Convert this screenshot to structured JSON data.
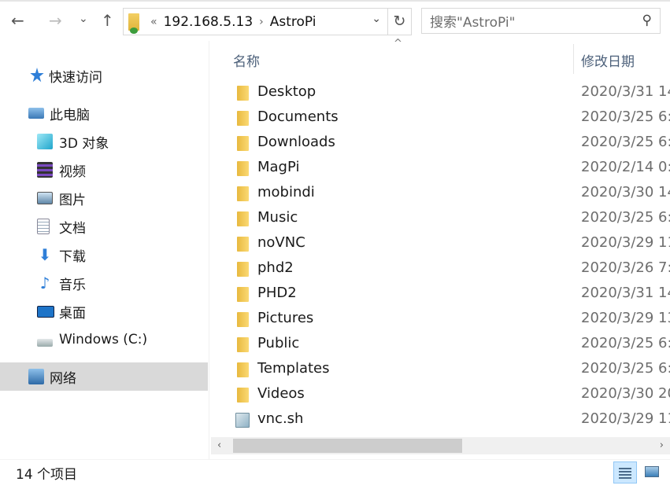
{
  "toolbar": {
    "back": "←",
    "forward": "→",
    "recent": "⌄",
    "up": "↑",
    "address": {
      "overflow": "«",
      "crumbs": [
        "192.168.5.13",
        "AstroPi"
      ],
      "separator": "›"
    },
    "dropdown": "⌄",
    "refresh": "↻",
    "search_placeholder": "搜索\"AstroPi\"",
    "search_icon": "⚲"
  },
  "sidebar": {
    "items": [
      {
        "label": "快速访问",
        "icon": "star-icon",
        "color": "#2f7fd8"
      },
      {
        "label": "此电脑",
        "icon": "computer-icon",
        "color": "#5a8fc4"
      },
      {
        "label": "3D 对象",
        "icon": "cube-icon",
        "color": "#2fb8d8"
      },
      {
        "label": "视频",
        "icon": "film-icon",
        "color": "#444"
      },
      {
        "label": "图片",
        "icon": "picture-icon",
        "color": "#6a8fb0"
      },
      {
        "label": "文档",
        "icon": "document-icon",
        "color": "#9aa"
      },
      {
        "label": "下载",
        "icon": "download-icon",
        "color": "#2f7fd8"
      },
      {
        "label": "音乐",
        "icon": "music-icon",
        "color": "#2f7fd8"
      },
      {
        "label": "桌面",
        "icon": "desktop-icon",
        "color": "#1e74c8"
      },
      {
        "label": "Windows (C:)",
        "icon": "drive-icon",
        "color": "#8aa"
      },
      {
        "label": "网络",
        "icon": "network-icon",
        "color": "#3a7fc0",
        "selected": true
      }
    ]
  },
  "columns": {
    "name": "名称",
    "date": "修改日期",
    "sort_indicator": "^"
  },
  "files": [
    {
      "name": "Desktop",
      "date": "2020/3/31 14",
      "type": "folder"
    },
    {
      "name": "Documents",
      "date": "2020/3/25 6:",
      "type": "folder"
    },
    {
      "name": "Downloads",
      "date": "2020/3/25 6:",
      "type": "folder"
    },
    {
      "name": "MagPi",
      "date": "2020/2/14 0:",
      "type": "folder"
    },
    {
      "name": "mobindi",
      "date": "2020/3/30 14",
      "type": "folder"
    },
    {
      "name": "Music",
      "date": "2020/3/25 6:",
      "type": "folder"
    },
    {
      "name": "noVNC",
      "date": "2020/3/29 11",
      "type": "folder"
    },
    {
      "name": "phd2",
      "date": "2020/3/26 7:",
      "type": "folder"
    },
    {
      "name": "PHD2",
      "date": "2020/3/31 14",
      "type": "folder"
    },
    {
      "name": "Pictures",
      "date": "2020/3/29 13",
      "type": "folder"
    },
    {
      "name": "Public",
      "date": "2020/3/25 6:",
      "type": "folder"
    },
    {
      "name": "Templates",
      "date": "2020/3/25 6:",
      "type": "folder"
    },
    {
      "name": "Videos",
      "date": "2020/3/30 20",
      "type": "folder"
    },
    {
      "name": "vnc.sh",
      "date": "2020/3/29 11",
      "type": "file"
    }
  ],
  "scrollbar": {
    "left": "‹",
    "right": "›"
  },
  "status": {
    "count": "14 个项目"
  }
}
